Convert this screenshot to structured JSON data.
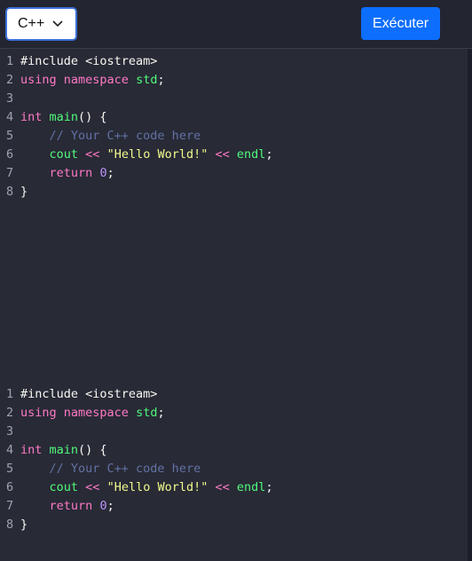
{
  "toolbar": {
    "language_selected": "C++",
    "run_label": "Exécuter"
  },
  "colors": {
    "run_button": "#0d6efd",
    "editor_background": "#282a36",
    "keyword": "#ff79c6",
    "function": "#50fa7b",
    "comment": "#6272a4",
    "string": "#f1fa8c",
    "number": "#bd93f9"
  },
  "editors": [
    {
      "lines": [
        {
          "n": "1",
          "tokens": [
            {
              "t": "#include <iostream>",
              "c": "code"
            }
          ]
        },
        {
          "n": "2",
          "tokens": [
            {
              "t": "using",
              "c": "kw"
            },
            {
              "t": " ",
              "c": "code"
            },
            {
              "t": "namespace",
              "c": "kw"
            },
            {
              "t": " ",
              "c": "code"
            },
            {
              "t": "std",
              "c": "fn"
            },
            {
              "t": ";",
              "c": "code"
            }
          ]
        },
        {
          "n": "3",
          "tokens": []
        },
        {
          "n": "4",
          "tokens": [
            {
              "t": "int",
              "c": "ty"
            },
            {
              "t": " ",
              "c": "code"
            },
            {
              "t": "main",
              "c": "fn"
            },
            {
              "t": "() {",
              "c": "code"
            }
          ]
        },
        {
          "n": "5",
          "tokens": [
            {
              "t": "    ",
              "c": "code"
            },
            {
              "t": "// Your C++ code here",
              "c": "cm"
            }
          ]
        },
        {
          "n": "6",
          "tokens": [
            {
              "t": "    ",
              "c": "code"
            },
            {
              "t": "cout",
              "c": "fn"
            },
            {
              "t": " ",
              "c": "code"
            },
            {
              "t": "<<",
              "c": "op"
            },
            {
              "t": " ",
              "c": "code"
            },
            {
              "t": "\"Hello World!\"",
              "c": "st"
            },
            {
              "t": " ",
              "c": "code"
            },
            {
              "t": "<<",
              "c": "op"
            },
            {
              "t": " ",
              "c": "code"
            },
            {
              "t": "endl",
              "c": "fn"
            },
            {
              "t": ";",
              "c": "code"
            }
          ]
        },
        {
          "n": "7",
          "tokens": [
            {
              "t": "    ",
              "c": "code"
            },
            {
              "t": "return",
              "c": "kw"
            },
            {
              "t": " ",
              "c": "code"
            },
            {
              "t": "0",
              "c": "nm"
            },
            {
              "t": ";",
              "c": "code"
            }
          ]
        },
        {
          "n": "8",
          "tokens": [
            {
              "t": "}",
              "c": "code"
            }
          ]
        }
      ]
    },
    {
      "lines": [
        {
          "n": "1",
          "tokens": [
            {
              "t": "#include <iostream>",
              "c": "code"
            }
          ]
        },
        {
          "n": "2",
          "tokens": [
            {
              "t": "using",
              "c": "kw"
            },
            {
              "t": " ",
              "c": "code"
            },
            {
              "t": "namespace",
              "c": "kw"
            },
            {
              "t": " ",
              "c": "code"
            },
            {
              "t": "std",
              "c": "fn"
            },
            {
              "t": ";",
              "c": "code"
            }
          ]
        },
        {
          "n": "3",
          "tokens": []
        },
        {
          "n": "4",
          "tokens": [
            {
              "t": "int",
              "c": "ty"
            },
            {
              "t": " ",
              "c": "code"
            },
            {
              "t": "main",
              "c": "fn"
            },
            {
              "t": "() {",
              "c": "code"
            }
          ]
        },
        {
          "n": "5",
          "tokens": [
            {
              "t": "    ",
              "c": "code"
            },
            {
              "t": "// Your C++ code here",
              "c": "cm"
            }
          ]
        },
        {
          "n": "6",
          "tokens": [
            {
              "t": "    ",
              "c": "code"
            },
            {
              "t": "cout",
              "c": "fn"
            },
            {
              "t": " ",
              "c": "code"
            },
            {
              "t": "<<",
              "c": "op"
            },
            {
              "t": " ",
              "c": "code"
            },
            {
              "t": "\"Hello World!\"",
              "c": "st"
            },
            {
              "t": " ",
              "c": "code"
            },
            {
              "t": "<<",
              "c": "op"
            },
            {
              "t": " ",
              "c": "code"
            },
            {
              "t": "endl",
              "c": "fn"
            },
            {
              "t": ";",
              "c": "code"
            }
          ]
        },
        {
          "n": "7",
          "tokens": [
            {
              "t": "    ",
              "c": "code"
            },
            {
              "t": "return",
              "c": "kw"
            },
            {
              "t": " ",
              "c": "code"
            },
            {
              "t": "0",
              "c": "nm"
            },
            {
              "t": ";",
              "c": "code"
            }
          ]
        },
        {
          "n": "8",
          "tokens": [
            {
              "t": "}",
              "c": "code"
            }
          ]
        }
      ]
    }
  ]
}
